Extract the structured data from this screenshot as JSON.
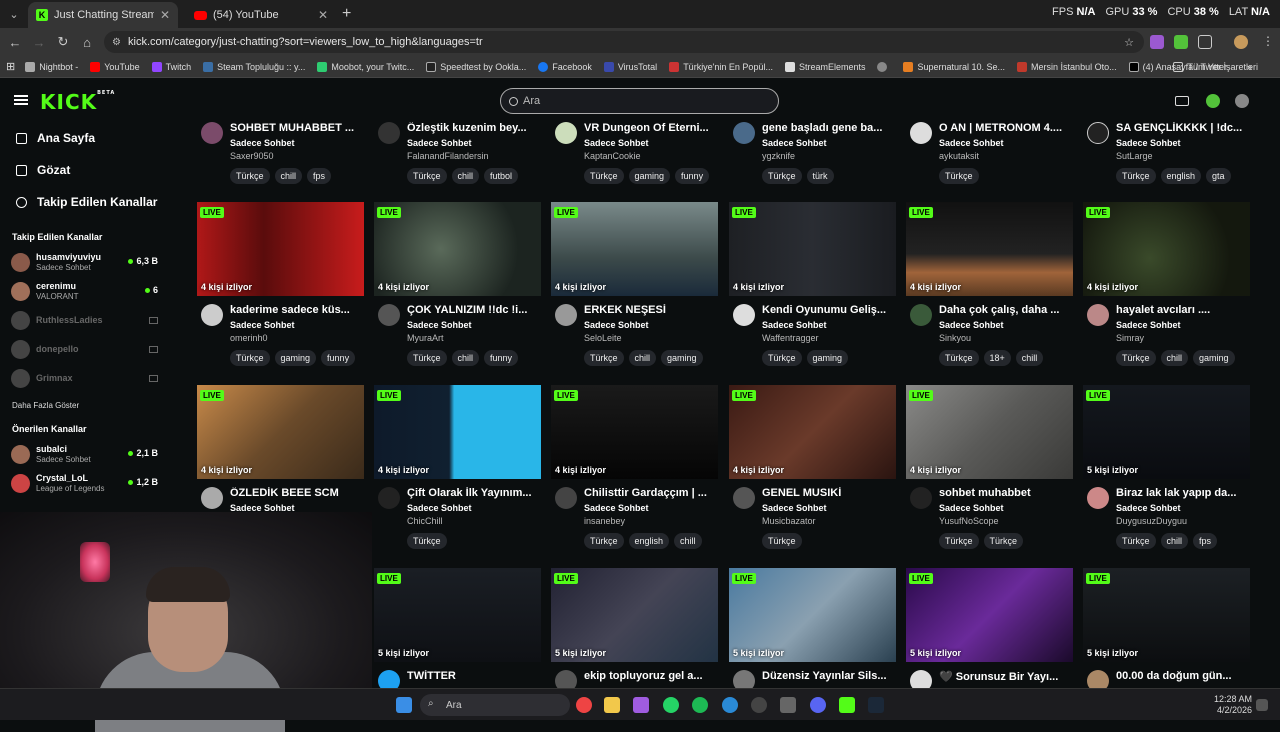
{
  "browser": {
    "tabs": [
      {
        "title": "Just Chatting Streaming - Live S",
        "active": true
      },
      {
        "title": "(54) YouTube",
        "active": false
      }
    ],
    "new_tab": "+",
    "stats": {
      "fps_label": "FPS",
      "fps_val": "N/A",
      "gpu_label": "GPU",
      "gpu_val": "33 %",
      "cpu_label": "CPU",
      "cpu_val": "38 %",
      "lat_label": "LAT",
      "lat_val": "N/A"
    },
    "url": "kick.com/category/just-chatting?sort=viewers_low_to_high&languages=tr",
    "bookmarks": [
      "Nightbot -",
      "YouTube",
      "Twitch",
      "Steam Topluluğu :: y...",
      "Moobot, your Twitc...",
      "Speedtest by Ookla...",
      "Facebook",
      "VirusTotal",
      "Türkiye'nin En Popül...",
      "StreamElements",
      "",
      "Supernatural 10. Se...",
      "Mersin İstanbul Oto...",
      "(4) Anasayfa / Twitter"
    ],
    "bookmarks_more": "»",
    "all_bookmarks": "Tüm Yer İşaretleri"
  },
  "kick": {
    "logo": "KICK",
    "logo_beta": "BETA",
    "search_placeholder": "Ara",
    "nav": [
      {
        "label": "Ana Sayfa",
        "icon": "home-icon"
      },
      {
        "label": "Gözat",
        "icon": "browse-icon"
      },
      {
        "label": "Takip Edilen Kanallar",
        "icon": "heart-icon"
      }
    ],
    "followed_title": "Takip Edilen Kanallar",
    "followed": [
      {
        "name": "husamviyuviyu",
        "cat": "Sadece Sohbet",
        "count": "6,3 B",
        "online": true
      },
      {
        "name": "cerenimu",
        "cat": "VALORANT",
        "count": "6",
        "online": true
      },
      {
        "name": "RuthlessLadies",
        "cat": "",
        "count": "",
        "online": false
      },
      {
        "name": "donepello",
        "cat": "",
        "count": "",
        "online": false
      },
      {
        "name": "Grimnax",
        "cat": "",
        "count": "",
        "online": false
      }
    ],
    "show_more": "Daha Fazla Göster",
    "recommended_title": "Önerilen Kanallar",
    "recommended": [
      {
        "name": "subalci",
        "cat": "Sadece Sohbet",
        "count": "2,1 B"
      },
      {
        "name": "Crystal_LoL",
        "cat": "League of Legends",
        "count": "1,2 B"
      }
    ]
  },
  "streams": {
    "row0": [
      {
        "title": "SOHBET MUHABBET ...",
        "cat": "Sadece Sohbet",
        "channel": "Saxer9050",
        "tags": [
          "Türkçe",
          "chill",
          "fps"
        ]
      },
      {
        "title": "Özleştik kuzenim bey...",
        "cat": "Sadece Sohbet",
        "channel": "FalanandFilandersin",
        "tags": [
          "Türkçe",
          "chill",
          "futbol"
        ]
      },
      {
        "title": "VR Dungeon Of Eterni...",
        "cat": "Sadece Sohbet",
        "channel": "KaptanCookie",
        "tags": [
          "Türkçe",
          "gaming",
          "funny"
        ]
      },
      {
        "title": "gene başladı gene ba...",
        "cat": "Sadece Sohbet",
        "channel": "ygzknife",
        "tags": [
          "Türkçe",
          "türk"
        ]
      },
      {
        "title": "O AN | METRONOM 4....",
        "cat": "Sadece Sohbet",
        "channel": "aykutaksit",
        "tags": [
          "Türkçe"
        ]
      },
      {
        "title": "SA GENÇLİKKKK | !dc...",
        "cat": "Sadece Sohbet",
        "channel": "SutLarge",
        "tags": [
          "Türkçe",
          "english",
          "gta"
        ]
      }
    ],
    "row1": [
      {
        "live": "LIVE",
        "viewers": "4 kişi izliyor",
        "title": "kaderime sadece küs...",
        "cat": "Sadece Sohbet",
        "channel": "omerinh0",
        "tags": [
          "Türkçe",
          "gaming",
          "funny"
        ]
      },
      {
        "live": "LIVE",
        "viewers": "4 kişi izliyor",
        "title": "ÇOK YALNIZIM !!dc !i...",
        "cat": "Sadece Sohbet",
        "channel": "MyuraArt",
        "tags": [
          "Türkçe",
          "chill",
          "funny"
        ]
      },
      {
        "live": "LIVE",
        "viewers": "4 kişi izliyor",
        "title": "ERKEK NEŞESİ",
        "cat": "Sadece Sohbet",
        "channel": "SeloLeite",
        "tags": [
          "Türkçe",
          "chill",
          "gaming"
        ]
      },
      {
        "live": "LIVE",
        "viewers": "4 kişi izliyor",
        "title": "Kendi Oyunumu Geliş...",
        "cat": "Sadece Sohbet",
        "channel": "Waffentragger",
        "tags": [
          "Türkçe",
          "gaming"
        ]
      },
      {
        "live": "LIVE",
        "viewers": "4 kişi izliyor",
        "title": "Daha çok çalış, daha ...",
        "cat": "Sadece Sohbet",
        "channel": "Sinkyou",
        "tags": [
          "Türkçe",
          "18+",
          "chill"
        ]
      },
      {
        "live": "LIVE",
        "viewers": "4 kişi izliyor",
        "title": "hayalet avcıları ....",
        "cat": "Sadece Sohbet",
        "channel": "Simray",
        "tags": [
          "Türkçe",
          "chill",
          "gaming"
        ]
      }
    ],
    "row2": [
      {
        "live": "LIVE",
        "viewers": "4 kişi izliyor",
        "title": "ÖZLEDİK BEEE SCM",
        "cat": "Sadece Sohbet",
        "channel": "",
        "tags": []
      },
      {
        "live": "LIVE",
        "viewers": "4 kişi izliyor",
        "title": "Çift Olarak İlk Yayınım...",
        "cat": "Sadece Sohbet",
        "channel": "ChicChill",
        "tags": [
          "Türkçe"
        ]
      },
      {
        "live": "LIVE",
        "viewers": "4 kişi izliyor",
        "title": "Chilisttir Gardaççım | ...",
        "cat": "Sadece Sohbet",
        "channel": "insanebey",
        "tags": [
          "Türkçe",
          "english",
          "chill"
        ]
      },
      {
        "live": "LIVE",
        "viewers": "4 kişi izliyor",
        "title": "GENEL MUSIKİ",
        "cat": "Sadece Sohbet",
        "channel": "Musicbazator",
        "tags": [
          "Türkçe"
        ]
      },
      {
        "live": "LIVE",
        "viewers": "4 kişi izliyor",
        "title": "sohbet muhabbet",
        "cat": "Sadece Sohbet",
        "channel": "YusufNoScope",
        "tags": [
          "Türkçe",
          "Türkçe"
        ]
      },
      {
        "live": "LIVE",
        "viewers": "5 kişi izliyor",
        "title": "Biraz lak lak yapıp da...",
        "cat": "Sadece Sohbet",
        "channel": "DuygusuzDuyguu",
        "tags": [
          "Türkçe",
          "chill",
          "fps"
        ]
      }
    ],
    "row3": [
      {
        "live": "LIVE",
        "viewers": "5 kişi izliyor",
        "title": "TWİTTER"
      },
      {
        "live": "LIVE",
        "viewers": "5 kişi izliyor",
        "title": "ekip topluyoruz gel a..."
      },
      {
        "live": "LIVE",
        "viewers": "5 kişi izliyor",
        "title": "Düzensiz Yayınlar Sils..."
      },
      {
        "live": "LIVE",
        "viewers": "5 kişi izliyor",
        "title": "🖤 Sorunsuz Bir Yayı..."
      },
      {
        "live": "LIVE",
        "viewers": "5 kişi izliyor",
        "title": "00.00 da doğum gün..."
      }
    ]
  },
  "taskbar": {
    "search": "Ara",
    "time": "12:28 AM",
    "date": "4/2/2026"
  }
}
